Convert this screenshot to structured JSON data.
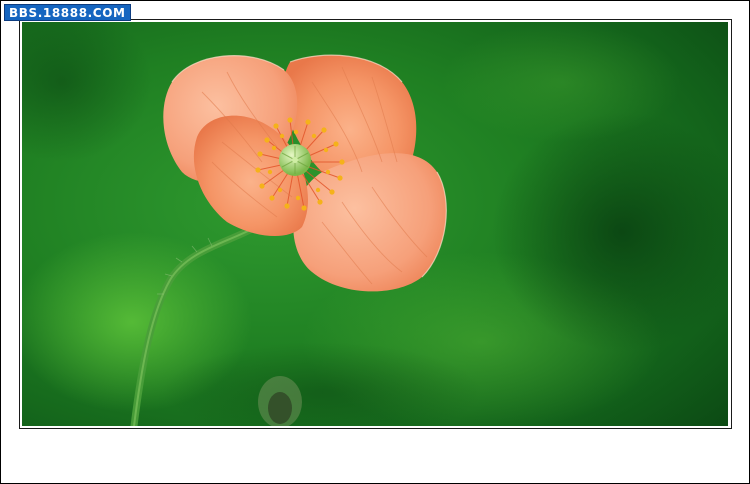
{
  "watermark": {
    "text": "BBS.18888.COM",
    "background_color": "#1565c0"
  },
  "photo": {
    "subject": "orange-poppy-flower-icon",
    "petal_color": "#f4986a",
    "center_color": "#a8d870",
    "stamen_color": "#f5b21a",
    "background_color": "#1f7a1f"
  }
}
